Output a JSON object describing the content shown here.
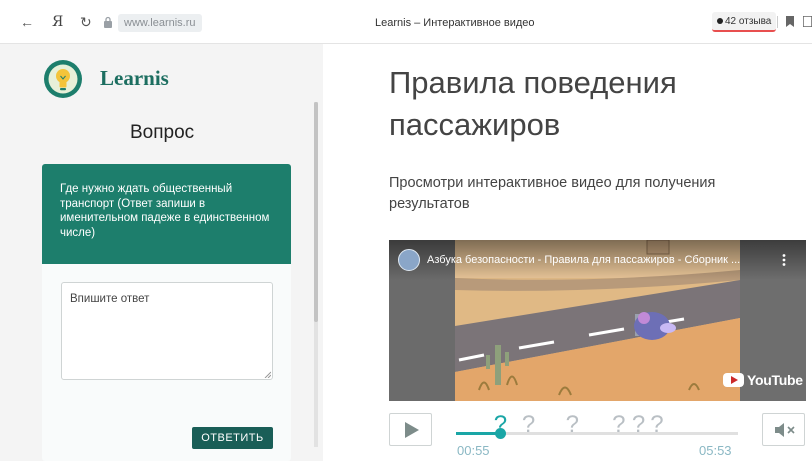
{
  "browser": {
    "back_glyph": "←",
    "yandex_glyph": "Я",
    "reload_glyph": "↻",
    "url": "www.learnis.ru",
    "tab_title": "Learnis – Интерактивное видео",
    "reviews": "42 отзыва",
    "icons": [
      "back-arrow-icon",
      "yandex-icon",
      "reload-icon",
      "lock-icon",
      "reviews-icon",
      "bookmark-icon",
      "extension-icon"
    ]
  },
  "sidebar": {
    "brand": "Learnis",
    "heading": "Вопрос",
    "question": "Где нужно ждать общественный транспорт (Ответ запиши в именительном падеже в единственном числе)",
    "answer_placeholder": "Впишите ответ",
    "answer_value": "",
    "submit_label": "ОТВЕТИТЬ",
    "logo_icon": "lightbulb-icon",
    "colors": {
      "brand": "#1c6e60",
      "question_bg": "#1d7e6c",
      "submit_bg": "#1a5e57"
    }
  },
  "main": {
    "title": "Правила поведения пассажиров",
    "subtitle": "Просмотри интерактивное видео для получения результатов"
  },
  "video": {
    "title": "Азбука безопасности - Правила для пассажиров - Сборник ...",
    "menu_icon": "more-vert-icon",
    "platform": "YouTube"
  },
  "player": {
    "current_time": "00:55",
    "total_time": "05:53",
    "progress_fraction": 0.155,
    "question_markers": [
      {
        "text": "?",
        "fraction": 0.155,
        "active": true
      },
      {
        "text": "?",
        "fraction": 0.255,
        "active": false
      },
      {
        "text": "?",
        "fraction": 0.41,
        "active": false
      },
      {
        "text": "?",
        "fraction": 0.575,
        "active": false
      },
      {
        "text": "?",
        "fraction": 0.645,
        "active": false
      },
      {
        "text": "?",
        "fraction": 0.71,
        "active": false
      }
    ],
    "colors": {
      "accent": "#1aa6a6",
      "marker": "#b9bfc4"
    }
  }
}
